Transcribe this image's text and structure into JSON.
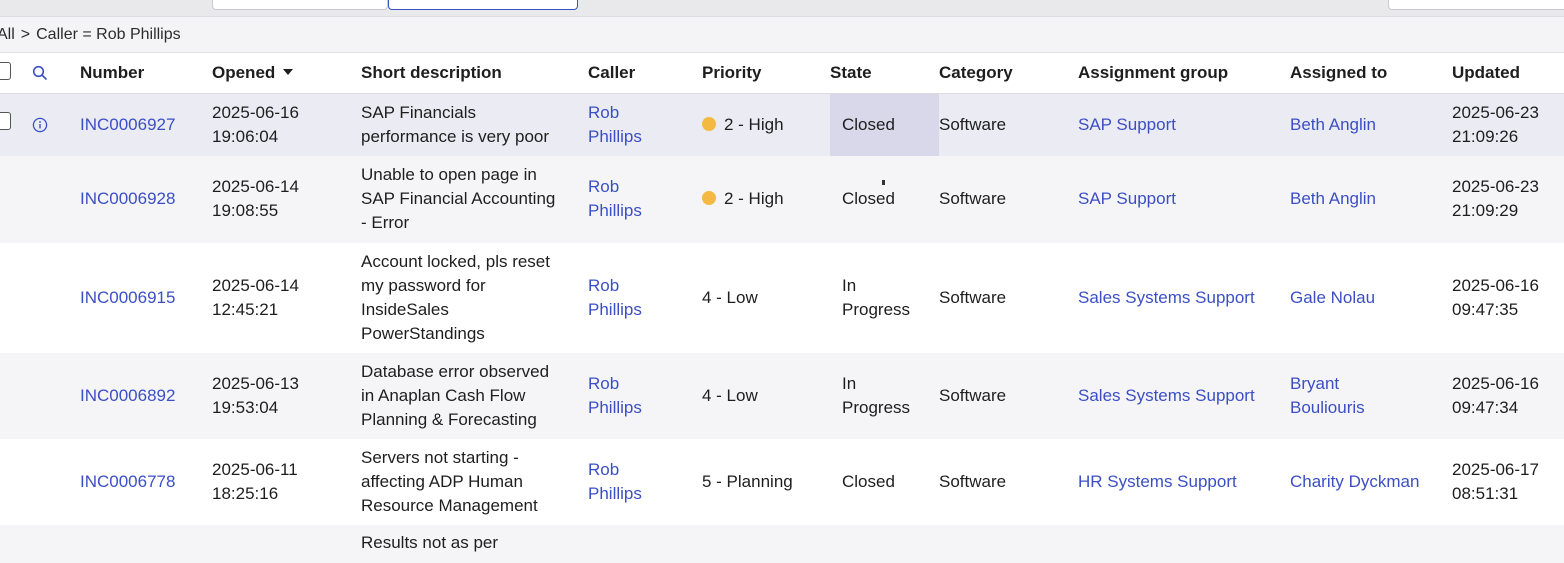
{
  "breadcrumb": {
    "root": "All",
    "separator": ">",
    "filter": "Caller = Rob Phillips"
  },
  "columns": {
    "number": "Number",
    "opened": "Opened",
    "short_description": "Short description",
    "caller": "Caller",
    "priority": "Priority",
    "state": "State",
    "category": "Category",
    "assignment_group": "Assignment group",
    "assigned_to": "Assigned to",
    "updated": "Updated"
  },
  "rows": [
    {
      "number": "INC0006927",
      "opened_date": "2025-06-16",
      "opened_time": "19:06:04",
      "desc": [
        "SAP Financials",
        "performance is very poor"
      ],
      "caller": [
        "Rob",
        "Phillips"
      ],
      "priority": "2 - High",
      "state": [
        "Closed"
      ],
      "category": "Software",
      "group": "SAP Support",
      "assigned": [
        "Beth Anglin"
      ],
      "updated_date": "2025-06-23",
      "updated_time": "21:09:26"
    },
    {
      "number": "INC0006928",
      "opened_date": "2025-06-14",
      "opened_time": "19:08:55",
      "desc": [
        "Unable to open page in",
        "SAP Financial Accounting",
        "- Error"
      ],
      "caller": [
        "Rob",
        "Phillips"
      ],
      "priority": "2 - High",
      "state": [
        "Closed"
      ],
      "category": "Software",
      "group": "SAP Support",
      "assigned": [
        "Beth Anglin"
      ],
      "updated_date": "2025-06-23",
      "updated_time": "21:09:29"
    },
    {
      "number": "INC0006915",
      "opened_date": "2025-06-14",
      "opened_time": "12:45:21",
      "desc": [
        "Account locked, pls reset",
        "my password for",
        "InsideSales",
        "PowerStandings"
      ],
      "caller": [
        "Rob",
        "Phillips"
      ],
      "priority": "4 - Low",
      "state": [
        "In",
        "Progress"
      ],
      "category": "Software",
      "group": "Sales Systems Support",
      "assigned": [
        "Gale Nolau"
      ],
      "updated_date": "2025-06-16",
      "updated_time": "09:47:35"
    },
    {
      "number": "INC0006892",
      "opened_date": "2025-06-13",
      "opened_time": "19:53:04",
      "desc": [
        "Database error observed",
        "in Anaplan Cash Flow",
        "Planning & Forecasting"
      ],
      "caller": [
        "Rob",
        "Phillips"
      ],
      "priority": "4 - Low",
      "state": [
        "In",
        "Progress"
      ],
      "category": "Software",
      "group": "Sales Systems Support",
      "assigned": [
        "Bryant",
        "Bouliouris"
      ],
      "updated_date": "2025-06-16",
      "updated_time": "09:47:34"
    },
    {
      "number": "INC0006778",
      "opened_date": "2025-06-11",
      "opened_time": "18:25:16",
      "desc": [
        "Servers not starting -",
        "affecting ADP Human",
        "Resource Management"
      ],
      "caller": [
        "Rob",
        "Phillips"
      ],
      "priority": "5 - Planning",
      "state": [
        "Closed"
      ],
      "category": "Software",
      "group": "HR Systems Support",
      "assigned": [
        "Charity Dyckman"
      ],
      "updated_date": "2025-06-17",
      "updated_time": "08:51:31"
    }
  ],
  "partial_row": {
    "desc": "Results not as per"
  },
  "colors": {
    "link": "#3b4fc4",
    "priority_high_dot": "#f4b942",
    "selected_row": "#ebebf3"
  },
  "icons": {
    "search": "search-icon",
    "info": "info-icon",
    "sort": "sort-descending-icon"
  }
}
